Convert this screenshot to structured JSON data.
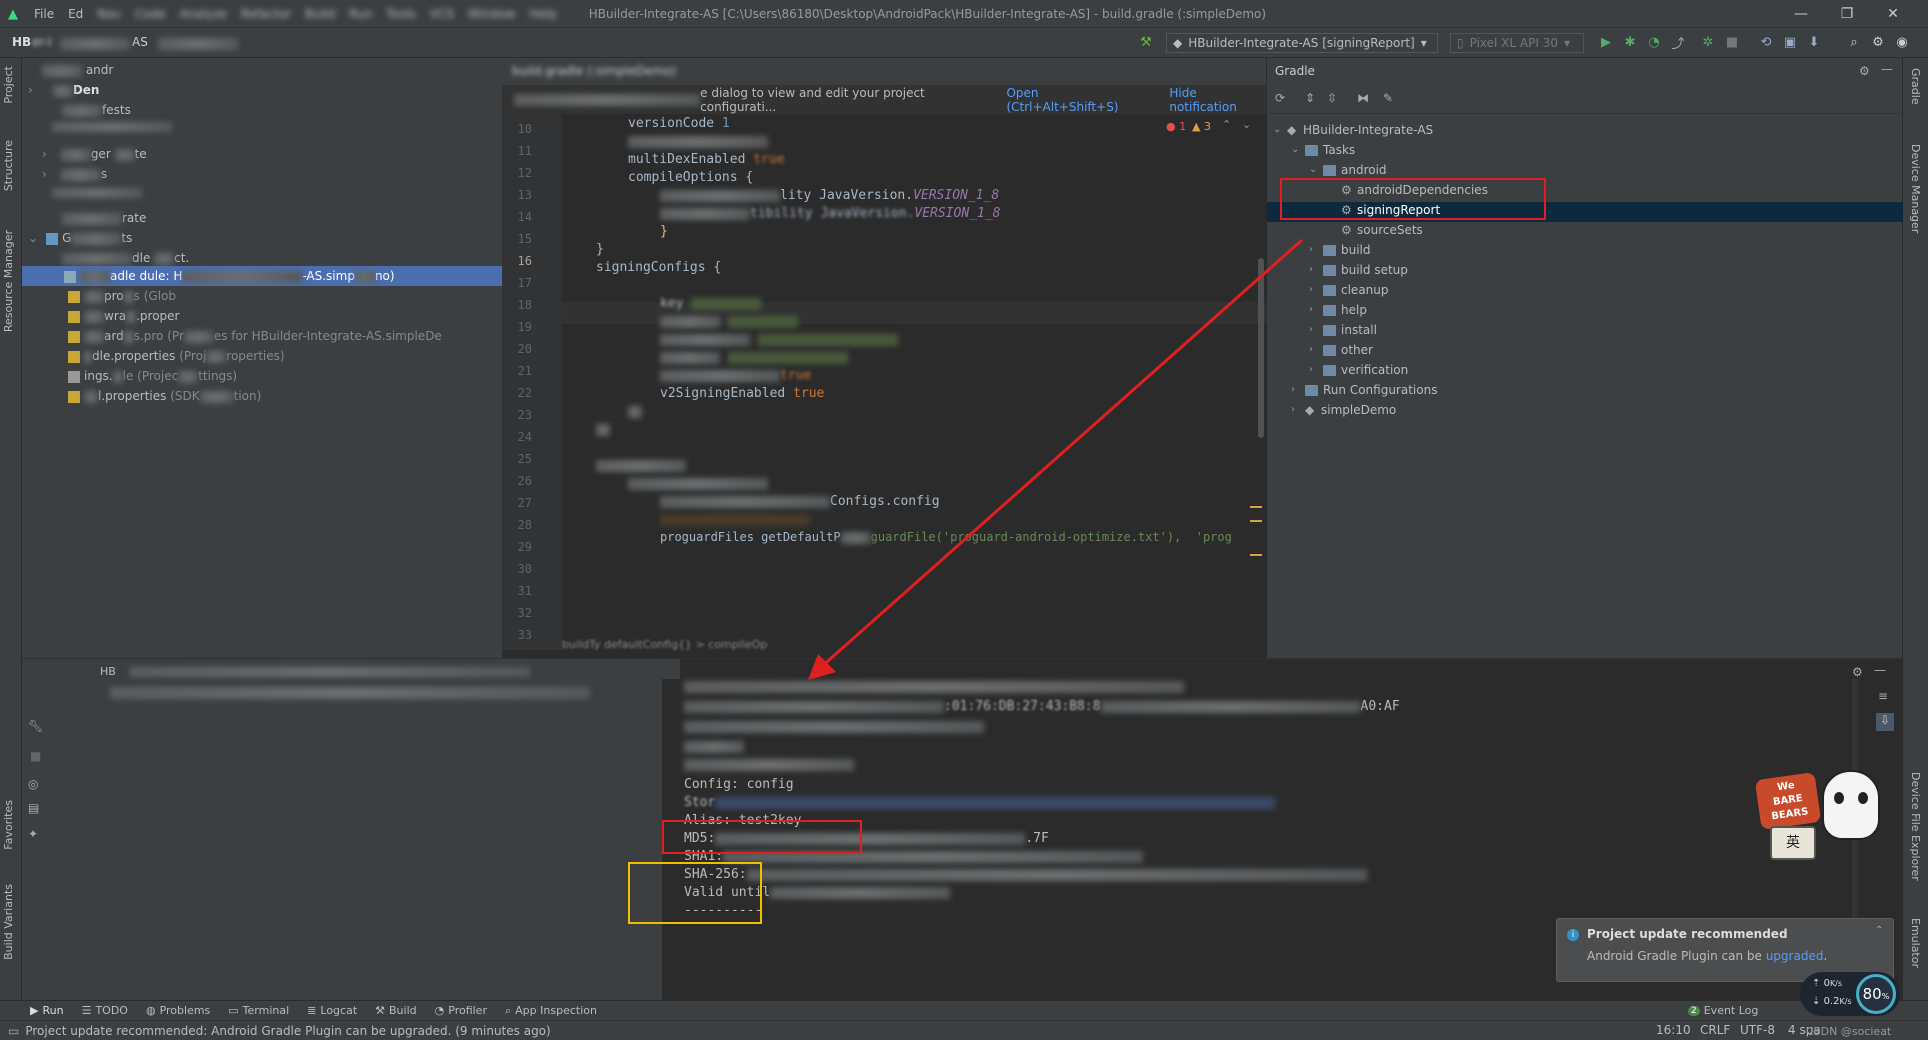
{
  "menubar": {
    "items": [
      "File",
      "Ed",
      "Nav",
      "Code",
      "Analyze",
      "Refactor",
      "Build",
      "Run",
      "Tools",
      "VCS",
      "Window",
      "Help"
    ],
    "window_title": "HBuilder-Integrate-AS [C:\\Users\\86180\\Desktop\\AndroidPack\\HBuilder-Integrate-AS] - build.gradle (:simpleDemo)",
    "minimize": "—",
    "maximize": "❐",
    "close": "✕"
  },
  "navbar": {
    "breadcrumb_start": "HB",
    "breadcrumb_mid": "er-I",
    "breadcrumb_end": "AS",
    "run_config": "HBuilder-Integrate-AS [signingReport]",
    "device": "Pixel XL API 30"
  },
  "left_strip": {
    "project": "Project",
    "structure": "Structure",
    "resource_manager": "Resource Manager",
    "favorites": "Favorites",
    "build_variants": "Build Variants"
  },
  "right_strip": {
    "gradle": "Gradle",
    "device_manager": "Device Manager",
    "device_file_explorer": "Device File Explorer",
    "emulator": "Emulator"
  },
  "project_tree": {
    "rows": [
      {
        "text": "andr",
        "suffix": ""
      },
      {
        "text": "Den",
        "suffix": ""
      },
      {
        "text": "fests",
        "suffix": ""
      },
      {
        "text": "ger",
        "suffix": "te"
      },
      {
        "text": "s",
        "suffix": ""
      },
      {
        "text": "rate",
        "suffix": ""
      },
      {
        "text": "G",
        "suffix": "ts"
      },
      {
        "text": "dle",
        "suffix": "ct."
      },
      {
        "text": "adle",
        "suffix": "dule: H"
      },
      {
        "text": "pro",
        "suffix": "s (Glob"
      },
      {
        "text": "wra",
        "suffix": ".proper"
      },
      {
        "text": "ard",
        "suffix": "s.pro (Pr"
      },
      {
        "text": "dle.properties",
        "suffix": "(Proj"
      },
      {
        "text": "ings.",
        "suffix": "le (Projec"
      },
      {
        "text": "l.properties",
        "suffix": "(SDK"
      }
    ],
    "selected_suffix": "-AS.simp",
    "selected_tail": "no)",
    "proguard_tail": "es for HBuilder-Integrate-AS.simpleDe",
    "dle_tail": "roperties)",
    "ings_tail": "ttings)",
    "sdk_tail": "tion)"
  },
  "editor": {
    "tab": "build.gradle (:simpleDemo)",
    "notification": "e dialog to view and edit your project configurati...",
    "notification_link": "Open (Ctrl+Alt+Shift+S)",
    "hide_link": "Hide notification",
    "errors": "1",
    "warnings": "3",
    "line_numbers": [
      "10",
      "11",
      "12",
      "13",
      "14",
      "15",
      "16",
      "17",
      "18",
      "19",
      "20",
      "21",
      "22",
      "23",
      "24",
      "25",
      "26",
      "27",
      "28",
      "29",
      "30",
      "31",
      "32",
      "33"
    ],
    "versionCode_kw": "versionCode",
    "versionCode_val": "1",
    "multiDex": "multiDexEnabled",
    "multiDex_val": "true",
    "compileOptions": "compileOptions {",
    "java_line_a": "lity JavaVersion.",
    "java_line_b": "tibility JavaVersion.",
    "java_ver": "VERSION_1_8",
    "close_brace": "}",
    "close_brace2": "}",
    "signingConfigs": "signingConfigs {",
    "key_line": "key",
    "v1": "true",
    "v2": "v2SigningEnabled",
    "v2_val": "true",
    "configs": "Configs.config",
    "proguard": "proguardFiles getDefaultP",
    "proguard_b": "guardFile('proguard-android-optimize.txt'),  'prog",
    "crumbs": "buildTy  defaultConfig{}  >  compileOp"
  },
  "gradle": {
    "header": "Gradle",
    "tree": [
      {
        "label": "HBuilder-Integrate-AS",
        "level": 0,
        "expanded": true,
        "type": "root"
      },
      {
        "label": "Tasks",
        "level": 1,
        "expanded": true,
        "type": "folder"
      },
      {
        "label": "android",
        "level": 2,
        "expanded": true,
        "type": "folder"
      },
      {
        "label": "androidDependencies",
        "level": 3,
        "type": "task"
      },
      {
        "label": "signingReport",
        "level": 3,
        "type": "task",
        "selected": true
      },
      {
        "label": "sourceSets",
        "level": 3,
        "type": "task"
      },
      {
        "label": "build",
        "level": 2,
        "expanded": false,
        "type": "folder"
      },
      {
        "label": "build setup",
        "level": 2,
        "expanded": false,
        "type": "folder"
      },
      {
        "label": "cleanup",
        "level": 2,
        "expanded": false,
        "type": "folder"
      },
      {
        "label": "help",
        "level": 2,
        "expanded": false,
        "type": "folder"
      },
      {
        "label": "install",
        "level": 2,
        "expanded": false,
        "type": "folder"
      },
      {
        "label": "other",
        "level": 2,
        "expanded": false,
        "type": "folder"
      },
      {
        "label": "verification",
        "level": 2,
        "expanded": false,
        "type": "folder"
      },
      {
        "label": "Run Configurations",
        "level": 1,
        "expanded": false,
        "type": "folder"
      },
      {
        "label": "simpleDemo",
        "level": 1,
        "expanded": false,
        "type": "root"
      }
    ]
  },
  "run": {
    "tab_label": "HB",
    "console": {
      "mid_line": ":01:76:DB:27:43:B8:8",
      "mid_tail": "A0:AF",
      "config": "Config: config",
      "store": "Stor",
      "alias": "Alias: test2key",
      "md5": "MD5:",
      "md5_tail": ".7F",
      "sha1": "SHA1:",
      "sha256": "SHA-256:",
      "valid": "Valid until",
      "dashes": "----------"
    }
  },
  "balloon": {
    "title": "Project update recommended",
    "body_prefix": "Android Gradle Plugin can be",
    "body_link": "upgraded",
    "body_suffix": "."
  },
  "bottom_tabs": [
    "Run",
    "TODO",
    "Problems",
    "Terminal",
    "Logcat",
    "Build",
    "Profiler",
    "App Inspection"
  ],
  "event_log": "Event Log",
  "event_log_count": "2",
  "status": {
    "message": "Project update recommended: Android Gradle Plugin can be upgraded. (9 minutes ago)",
    "position": "16:10",
    "line_sep": "CRLF",
    "encoding": "UTF-8",
    "indent": "4 spa",
    "watermark": "CSDN @socieat"
  },
  "widget": {
    "up": "0",
    "up_unit": "K/s",
    "down": "0.2",
    "down_unit": "K/s",
    "percent": "80",
    "percent_sign": "%"
  },
  "sticker": {
    "line1": "We",
    "line2": "BARE",
    "line3": "BEARS",
    "char": "英"
  },
  "colors": {
    "selection": "#4b6eaf",
    "annotation_red": "#e02020",
    "annotation_yellow": "#f0c000",
    "accent_green": "#3ddc84"
  }
}
